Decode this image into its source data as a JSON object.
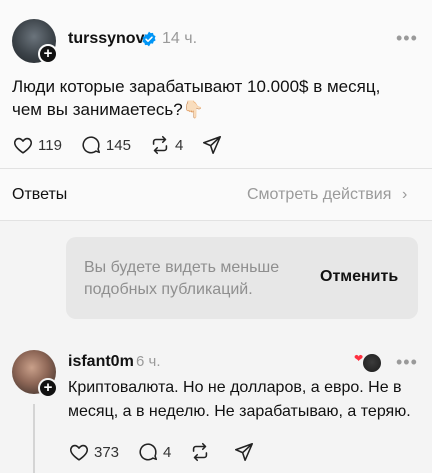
{
  "post": {
    "username": "turssynov",
    "time": "14 ч.",
    "text_line1": "Люди которые зарабатывают 10.000$ в месяц,",
    "text_line2": "чем вы занимаетесь?👇🏻",
    "likes": "119",
    "comments": "145",
    "reposts": "4"
  },
  "replies_bar": {
    "label": "Ответы",
    "view_activity": "Смотреть действия",
    "chevron": "›"
  },
  "hidden_notice": {
    "text": "Вы будете видеть меньше подобных публикаций.",
    "undo_label": "Отменить"
  },
  "reply": {
    "username": "isfant0m",
    "time": "6 ч.",
    "text": "Криптовалюта. Но не долларов, а евро. Не в месяц, а в неделю. Не зарабатываю, а теряю.",
    "likes": "373",
    "comments": "4"
  },
  "icons": {
    "more": "more-dots-icon",
    "like": "heart-icon",
    "comment": "comment-bubble-icon",
    "repost": "repost-icon",
    "share": "send-icon",
    "verified": "verified-badge-icon"
  },
  "colors": {
    "text": "#111111",
    "muted": "#9a9a9a",
    "verified": "#0095f6",
    "background": "#f4f4f4"
  }
}
